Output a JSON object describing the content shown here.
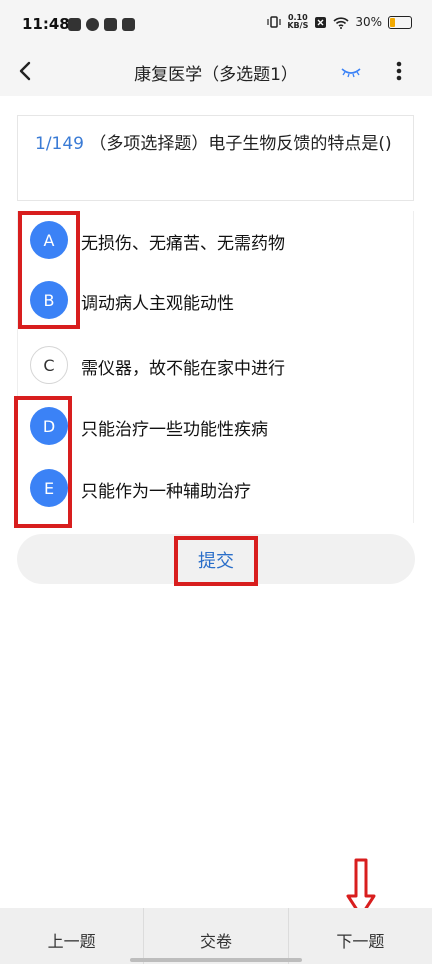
{
  "status_bar": {
    "time": "11:48",
    "net_speed_top": "0.10",
    "net_speed_bottom": "KB/S",
    "battery": "30%",
    "battery_level": 0.3
  },
  "header": {
    "title": "康复医学（多选题1）"
  },
  "question": {
    "number": "1/149",
    "text": "（多项选择题）电子生物反馈的特点是()"
  },
  "options": [
    {
      "letter": "A",
      "text": "无损伤、无痛苦、无需药物",
      "selected": true
    },
    {
      "letter": "B",
      "text": "调动病人主观能动性",
      "selected": true
    },
    {
      "letter": "C",
      "text": "需仪器，故不能在家中进行",
      "selected": false
    },
    {
      "letter": "D",
      "text": "只能治疗一些功能性疾病",
      "selected": true
    },
    {
      "letter": "E",
      "text": "只能作为一种辅助治疗",
      "selected": true
    }
  ],
  "submit_label": "提交",
  "bottom_bar": {
    "prev_label": "上一题",
    "submit_paper_label": "交卷",
    "next_label": "下一题"
  },
  "colors": {
    "accent": "#3b82f6",
    "link": "#2a6ec9",
    "highlight": "#d81e1e"
  }
}
